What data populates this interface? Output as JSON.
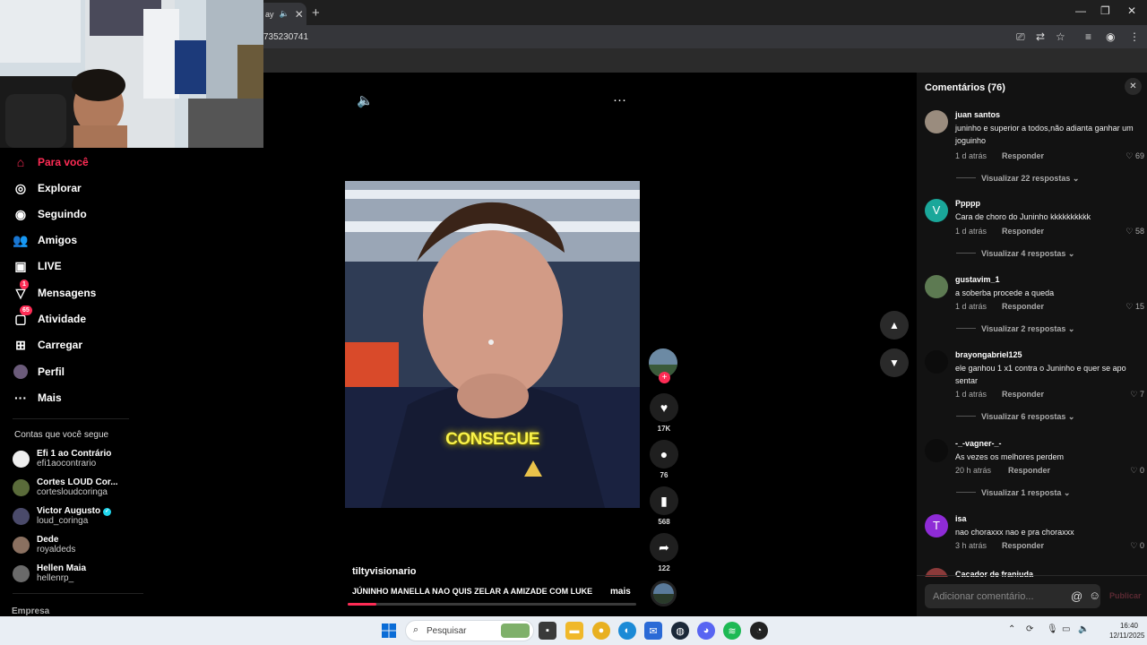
{
  "browser": {
    "tab_label": "ay",
    "url_partial": "735230741"
  },
  "sidebar": {
    "nav": [
      {
        "label": "Para você",
        "icon": "home-icon"
      },
      {
        "label": "Explorar",
        "icon": "compass-icon"
      },
      {
        "label": "Seguindo",
        "icon": "following-icon"
      },
      {
        "label": "Amigos",
        "icon": "friends-icon"
      },
      {
        "label": "LIVE",
        "icon": "live-icon"
      },
      {
        "label": "Mensagens",
        "icon": "messages-icon",
        "badge": "1"
      },
      {
        "label": "Atividade",
        "icon": "activity-icon",
        "badge": "65"
      },
      {
        "label": "Carregar",
        "icon": "upload-icon"
      },
      {
        "label": "Perfil",
        "icon": "profile-icon"
      },
      {
        "label": "Mais",
        "icon": "more-icon"
      }
    ],
    "following_title": "Contas que você segue",
    "following": [
      {
        "name": "Efi 1 ao Contrário",
        "handle": "efi1aocontrario"
      },
      {
        "name": "Cortes LOUD Cor...",
        "handle": "cortesloudcoringa"
      },
      {
        "name": "Victor Augusto",
        "handle": "loud_coringa",
        "verified": true
      },
      {
        "name": "Dede",
        "handle": "royaldeds"
      },
      {
        "name": "Hellen Maia",
        "handle": "hellenrp_"
      }
    ],
    "empresa": "Empresa"
  },
  "video": {
    "caption_word": "CONSEGUE",
    "author": "tiltyvisionario",
    "description": "JÚNINHO MANELLA NAO QUIS ZELAR A AMIZADE COM LUKE",
    "more_label": "mais",
    "progress": 0.1,
    "likes": "17K",
    "comments": "76",
    "saves": "568",
    "shares": "122"
  },
  "comments_panel": {
    "title": "Comentários (76)",
    "input_placeholder": "Adicionar comentário...",
    "publish_label": "Publicar",
    "reply_label": "Responder",
    "items": [
      {
        "user": "juan santos",
        "text": "juninho e superior a todos,não adianta ganhar um joguinho",
        "time": "1 d atrás",
        "likes": "69",
        "view_replies": "Visualizar 22 respostas",
        "avatar_color": "#9a8c7e"
      },
      {
        "user": "Ppppp",
        "text": "Cara de choro do Juninho kkkkkkkkkk",
        "time": "1 d atrás",
        "likes": "58",
        "view_replies": "Visualizar 4 respostas",
        "avatar_letter": "V",
        "avatar_color": "#1aa79a"
      },
      {
        "user": "gustavim_1",
        "text": "a soberba procede a queda",
        "time": "1 d atrás",
        "likes": "15",
        "view_replies": "Visualizar 2 respostas",
        "avatar_color": "#5d7a52"
      },
      {
        "user": "brayongabriel125",
        "text": "ele ganhou 1 x1 contra o Juninho e quer se apo sentar",
        "time": "1 d atrás",
        "likes": "7",
        "view_replies": "Visualizar 6 respostas",
        "avatar_color": "#0c0c0c"
      },
      {
        "user": "-_-vagner-_-",
        "text": "As vezes os melhores perdem",
        "time": "20 h atrás",
        "likes": "0",
        "view_replies": "Visualizar 1 resposta",
        "avatar_color": "#0c0c0c"
      },
      {
        "user": "isa",
        "text": "nao choraxxx nao e pra choraxxx",
        "time": "3 h atrás",
        "likes": "0",
        "avatar_letter": "T",
        "avatar_color": "#8e2bd6"
      },
      {
        "user": "Cacador de franjuda",
        "text": "",
        "time": "",
        "likes": "",
        "avatar_color": "#8b3a3a"
      }
    ]
  },
  "taskbar": {
    "search_placeholder": "Pesquisar",
    "time": "16:40",
    "date": "12/11/2025"
  }
}
